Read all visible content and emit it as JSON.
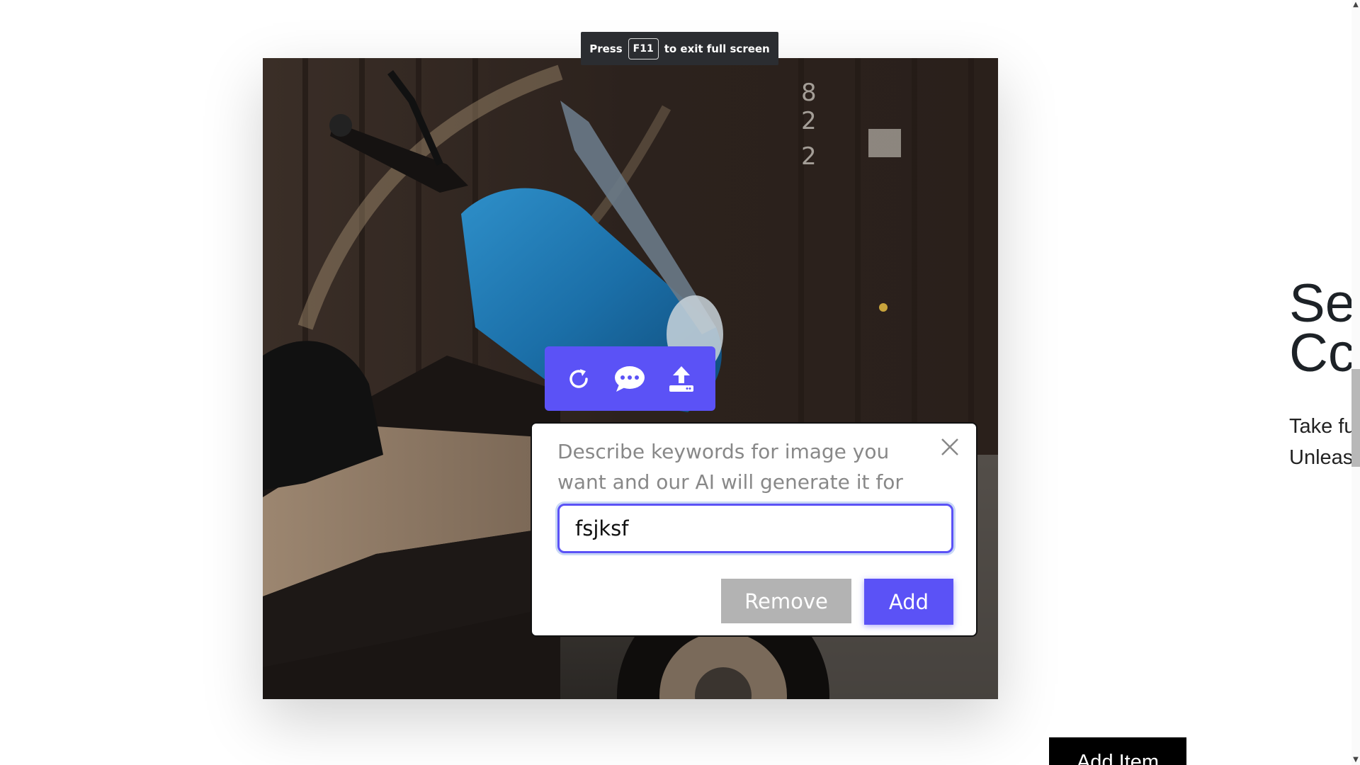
{
  "fullscreen_toast": {
    "prefix": "Press",
    "key": "F11",
    "suffix": "to exit full screen"
  },
  "toolbar": {
    "icons": [
      "refresh-icon",
      "chat-bubble-icon",
      "upload-icon"
    ]
  },
  "dialog": {
    "description": "Describe keywords for image you want and our AI will generate it for you",
    "input_value": "fsjksf",
    "remove_label": "Remove",
    "add_label": "Add"
  },
  "side_content": {
    "heading": "Se\nCc",
    "text": "Take fu\nUnleas"
  },
  "add_item_label": "Add Item",
  "colors": {
    "accent": "#5b52f6",
    "remove_gray": "#b3b3b3",
    "toast_bg": "#2b2d31"
  }
}
